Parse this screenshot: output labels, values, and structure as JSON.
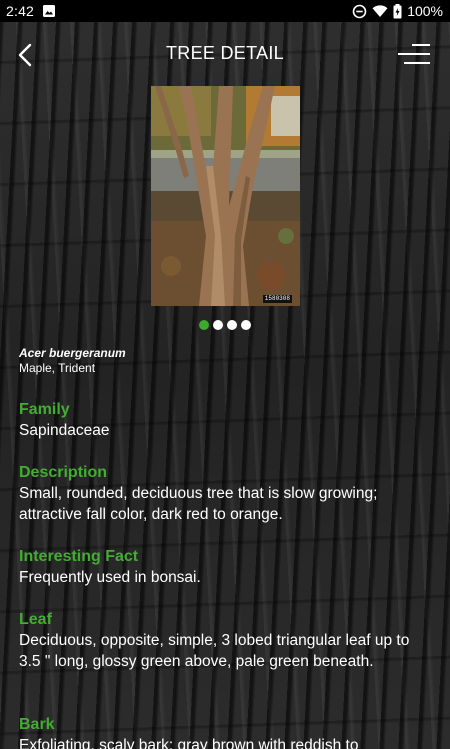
{
  "status_bar": {
    "time": "2:42",
    "battery": "100%"
  },
  "header": {
    "title": "TREE DETAIL"
  },
  "photo": {
    "tag": "1580308"
  },
  "pager": {
    "count": 4,
    "active": 0
  },
  "tree": {
    "botanical_name": "Acer buergeranum",
    "common_name": "Maple, Trident"
  },
  "sections": [
    {
      "title": "Family",
      "body": "Sapindaceae"
    },
    {
      "title": "Description",
      "body": "Small, rounded, deciduous tree that is slow growing; attractive fall color, dark red to orange."
    },
    {
      "title": "Interesting Fact",
      "body": "Frequently used in bonsai."
    },
    {
      "title": "Leaf",
      "body": "Deciduous, opposite, simple, 3 lobed triangular leaf up to 3.5 \" long, glossy green above, pale green beneath."
    },
    {
      "title": "Bark",
      "body": "Exfoliating, scaly bark; gray brown with reddish to"
    }
  ],
  "colors": {
    "accent_green": "#43ad32",
    "active_dot": "#3aab2e",
    "status_bar_bg": "#000000"
  },
  "icons": {
    "back": "back-arrow-icon",
    "menu": "menu-icon",
    "gallery": "image-icon",
    "dnd": "do-not-disturb-icon",
    "wifi": "wifi-icon",
    "battery": "battery-charging-icon"
  }
}
